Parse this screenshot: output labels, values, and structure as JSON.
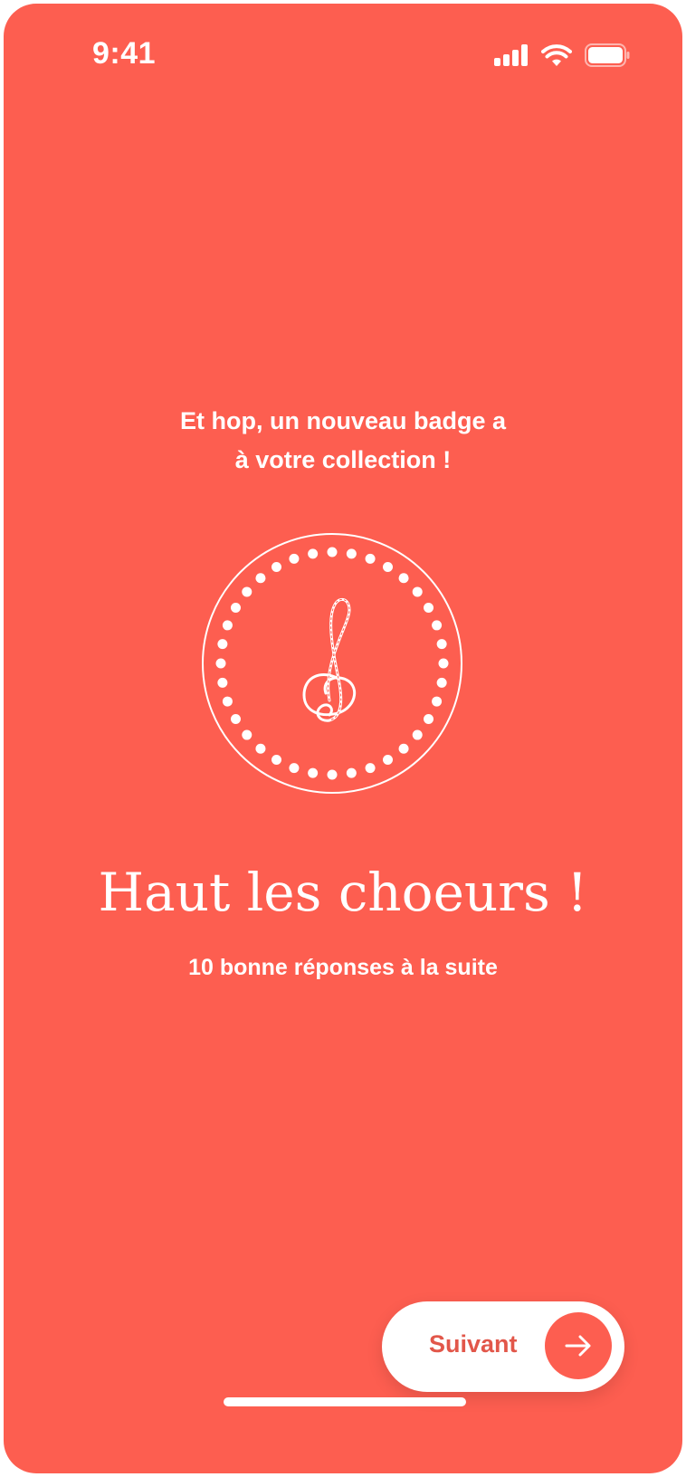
{
  "status_bar": {
    "time": "9:41"
  },
  "screen": {
    "background_color": "#FD5E50",
    "intro_line_1": "Et hop, un nouveau badge a",
    "intro_line_2": "à votre collection !"
  },
  "badge": {
    "icon": "treble-clef-icon",
    "title": "Haut les choeurs !",
    "description": "10 bonne réponses à la suite"
  },
  "footer": {
    "next_label": "Suivant",
    "next_icon": "arrow-right-icon",
    "accent_color": "#E2574A"
  }
}
